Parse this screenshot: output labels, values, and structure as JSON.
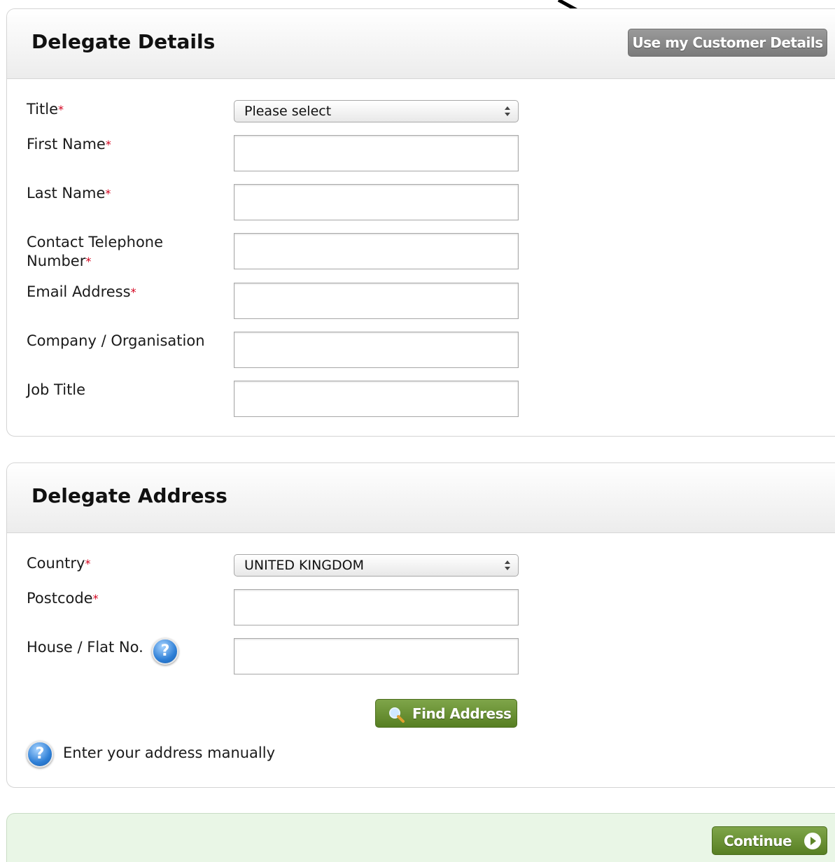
{
  "delegate_details": {
    "title": "Delegate Details",
    "use_customer_details_label": "Use my Customer Details",
    "fields": {
      "title": {
        "label": "Title",
        "value": "Please select"
      },
      "first_name": {
        "label": "First Name",
        "value": ""
      },
      "last_name": {
        "label": "Last Name",
        "value": ""
      },
      "telephone": {
        "label_line1": "Contact Telephone",
        "label_line2": "Number",
        "value": ""
      },
      "email": {
        "label": "Email Address",
        "value": ""
      },
      "company": {
        "label": "Company / Organisation",
        "value": ""
      },
      "job_title": {
        "label": "Job Title",
        "value": ""
      }
    },
    "required_marker": "*"
  },
  "delegate_address": {
    "title": "Delegate Address",
    "fields": {
      "country": {
        "label": "Country",
        "value": "UNITED KINGDOM"
      },
      "postcode": {
        "label": "Postcode",
        "value": ""
      },
      "house": {
        "label": "House / Flat No.",
        "value": ""
      }
    },
    "find_address_label": "Find Address",
    "manual_address_label": "Enter your address manually",
    "help_glyph": "?"
  },
  "footer": {
    "continue_label": "Continue"
  },
  "colors": {
    "required": "#d3001c",
    "green_button": "#6a9235",
    "grey_button": "#8a8a8a",
    "footer_bg": "#e9f6e6"
  },
  "icons": [
    "arrow-annotation-icon",
    "select-arrows-icon",
    "help-icon",
    "magnifier-icon",
    "play-circle-icon"
  ]
}
